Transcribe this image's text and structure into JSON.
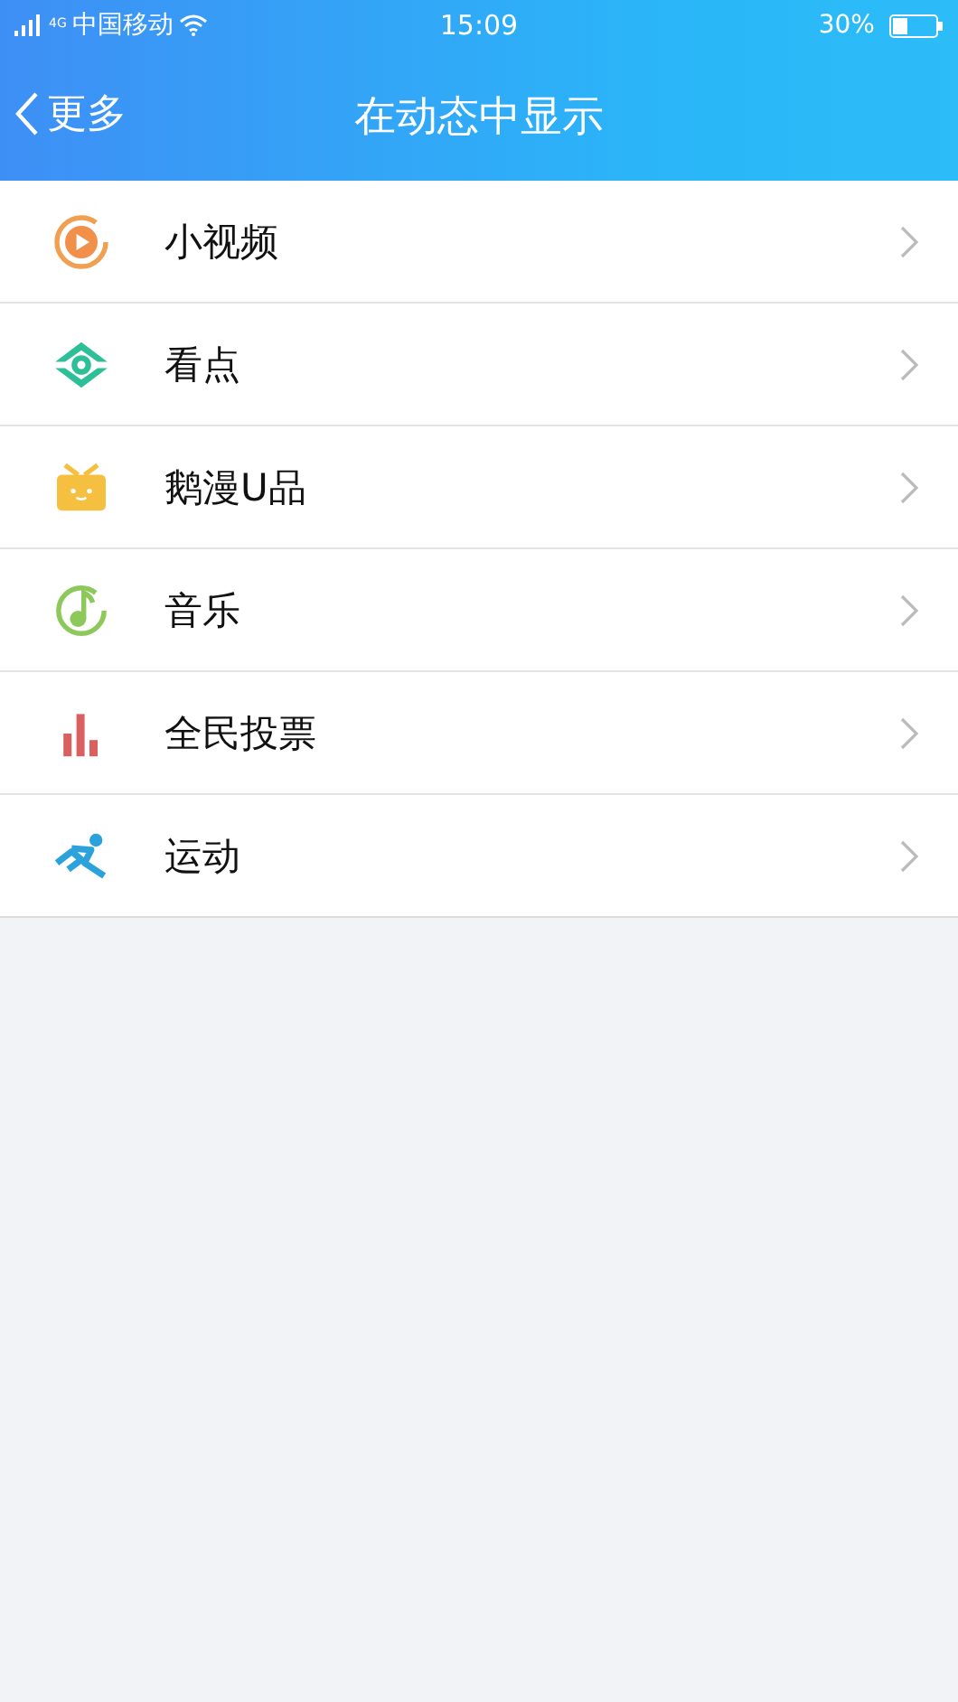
{
  "status_bar": {
    "network": "4G",
    "carrier": "中国移动",
    "time": "15:09",
    "battery": "30%"
  },
  "nav": {
    "back": "更多",
    "title": "在动态中显示"
  },
  "items": [
    {
      "kind": "video",
      "label": "小视频"
    },
    {
      "kind": "eye",
      "label": "看点"
    },
    {
      "kind": "gift",
      "label": "鹅漫U品"
    },
    {
      "kind": "music",
      "label": "音乐"
    },
    {
      "kind": "vote",
      "label": "全民投票"
    },
    {
      "kind": "sport",
      "label": "运动"
    }
  ]
}
